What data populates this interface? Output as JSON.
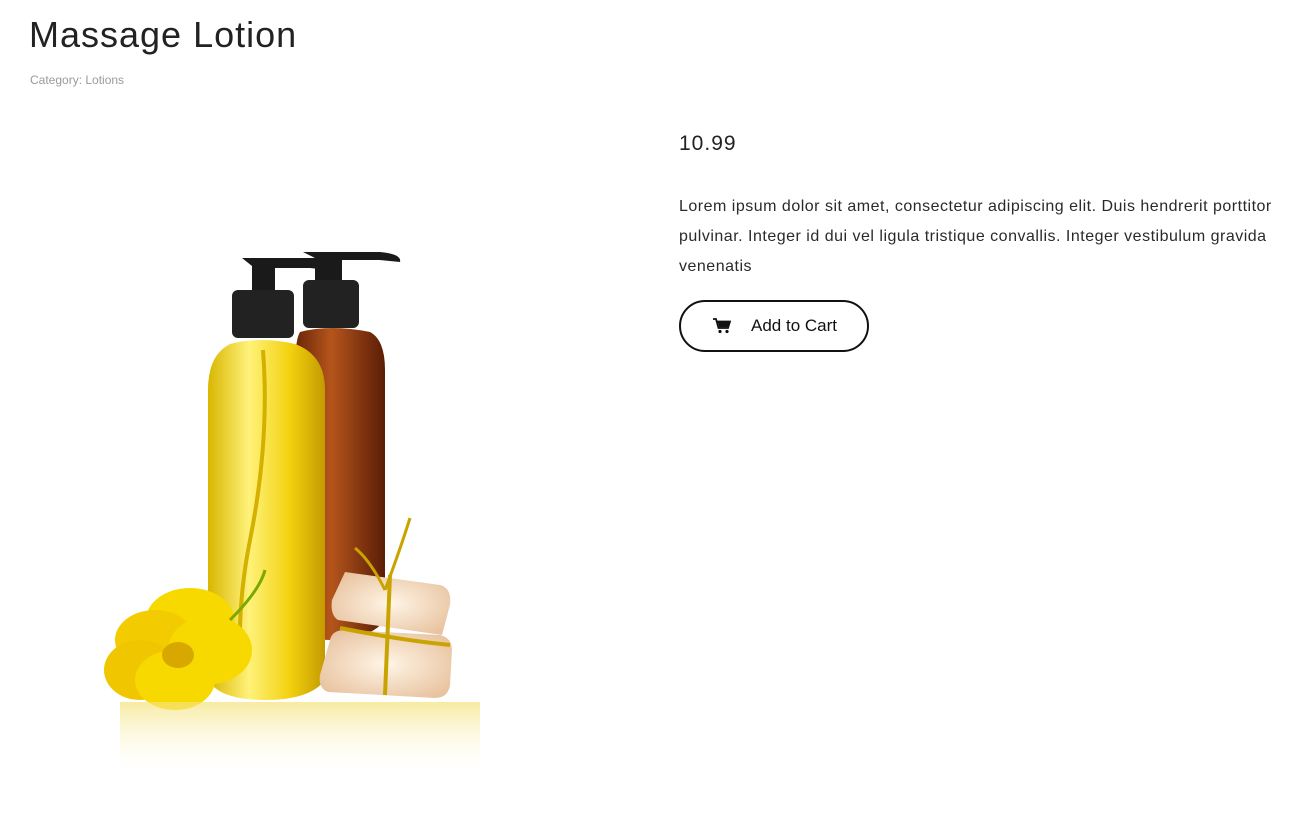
{
  "product": {
    "title": "Massage Lotion",
    "category": "Category: Lotions",
    "price": "10.99",
    "description": "Lorem ipsum dolor sit amet, consectetur adipiscing elit. Duis hendrerit porttitor pulvinar. Integer id dui vel ligula tristique convallis. Integer vestibulum gravida venenatis",
    "image_icon": "product-photo-icon"
  },
  "actions": {
    "add_to_cart_label": "Add to Cart",
    "cart_icon": "cart-icon"
  },
  "colors": {
    "text": "#222222",
    "muted": "#9a9a9a",
    "button_border": "#111111",
    "oil_yellow": "#f2d21a",
    "oil_amber": "#8a3a12",
    "flower_yellow": "#f7d900"
  }
}
